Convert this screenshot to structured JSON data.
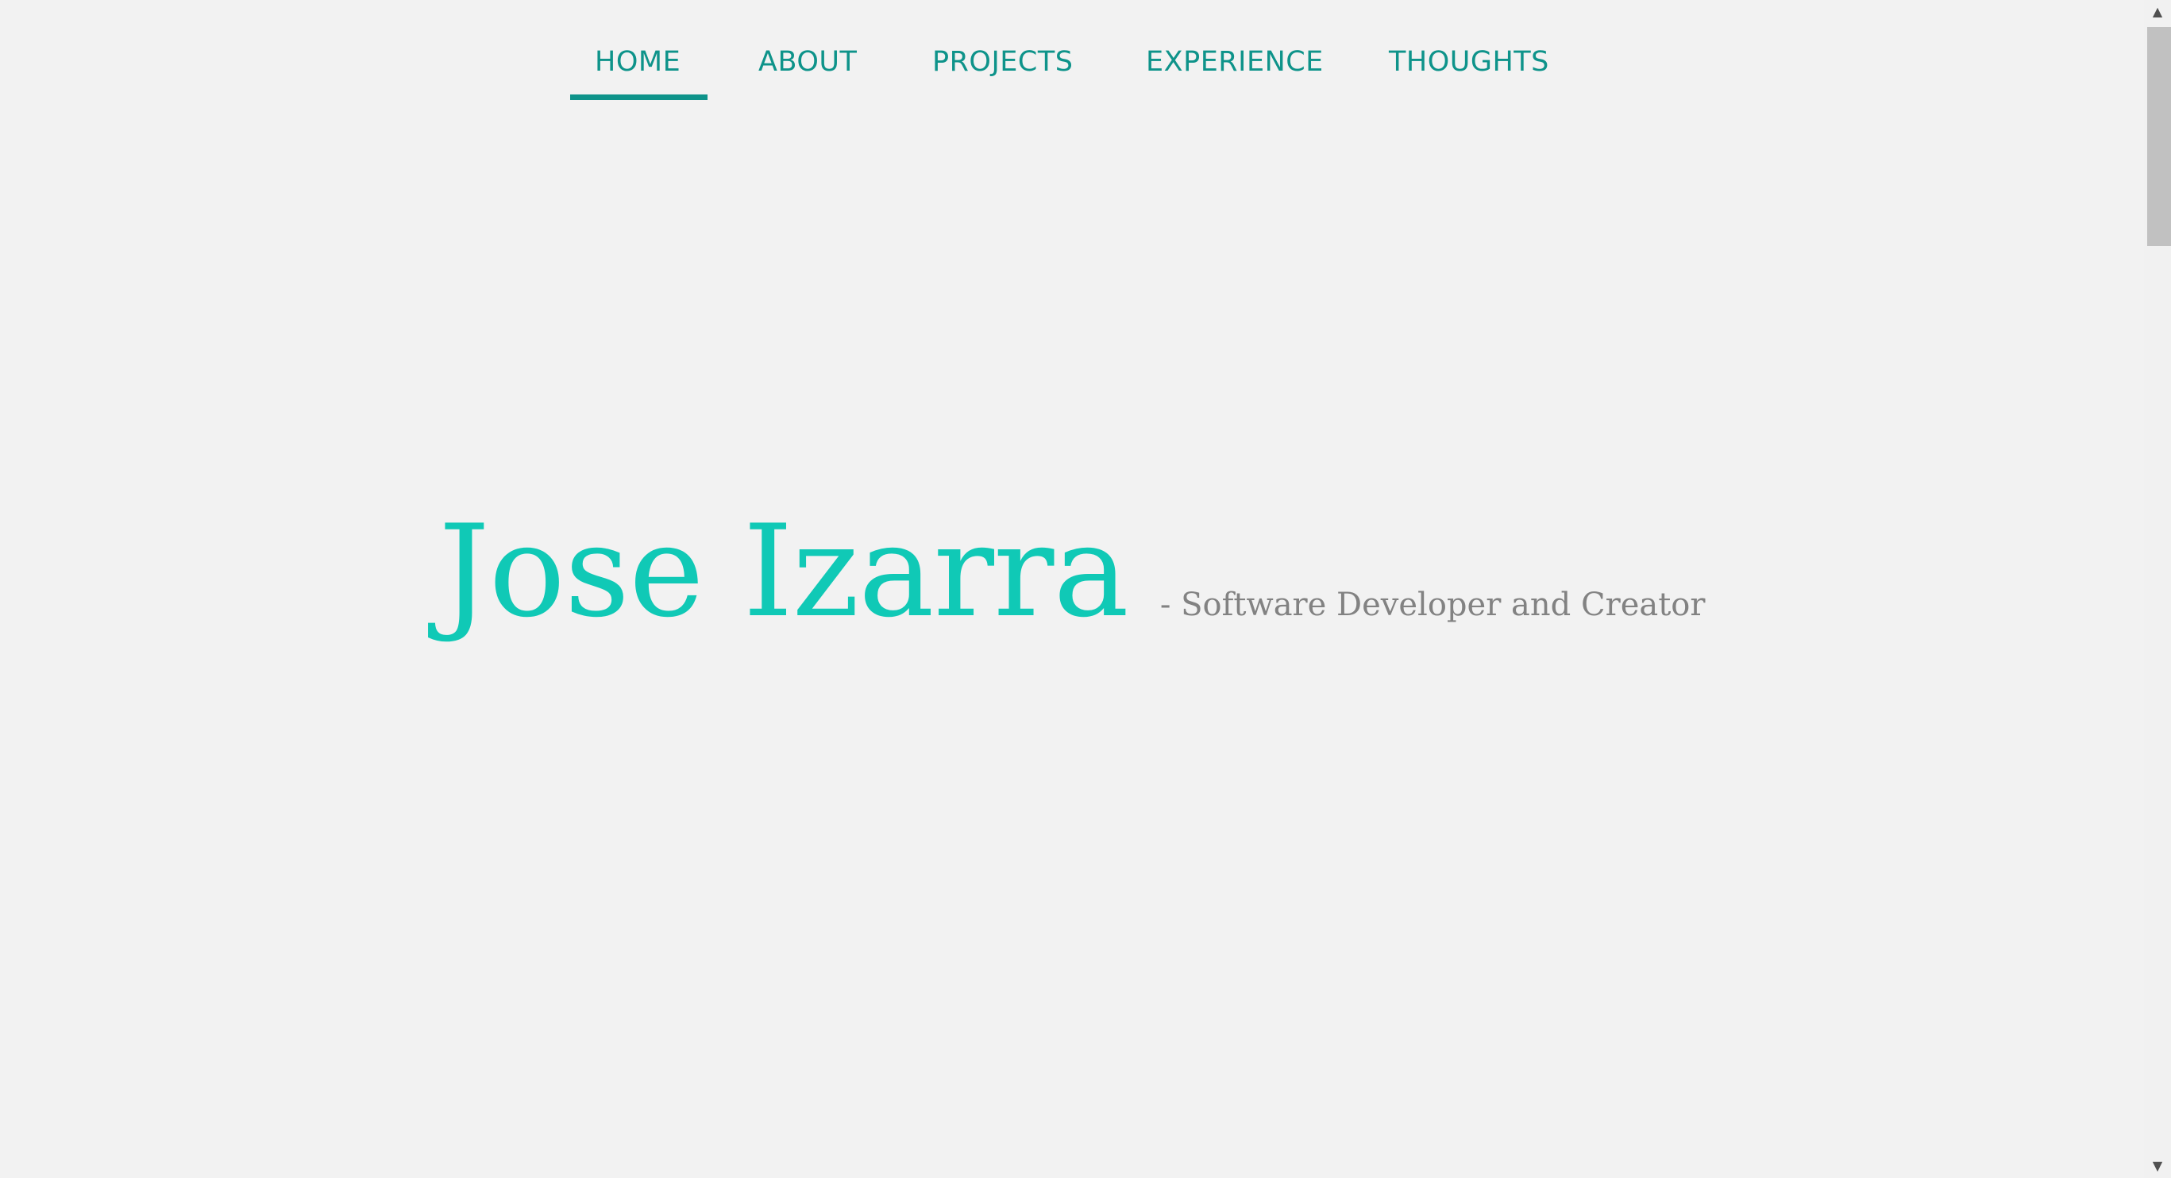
{
  "nav": {
    "items": [
      {
        "label": "HOME",
        "active": true
      },
      {
        "label": "ABOUT"
      },
      {
        "label": "PROJECTS"
      },
      {
        "label": "EXPERIENCE"
      },
      {
        "label": "THOUGHTS"
      }
    ]
  },
  "hero": {
    "name": "Jose Izarra",
    "tagline": "- Software Developer and Creator"
  },
  "colors": {
    "background": "#f2f2f2",
    "nav": "#0e938a",
    "name": "#10c9b6",
    "tagline": "#828282"
  },
  "scrollbar": {
    "up_icon": "triangle-up-icon",
    "down_icon": "triangle-down-icon"
  }
}
